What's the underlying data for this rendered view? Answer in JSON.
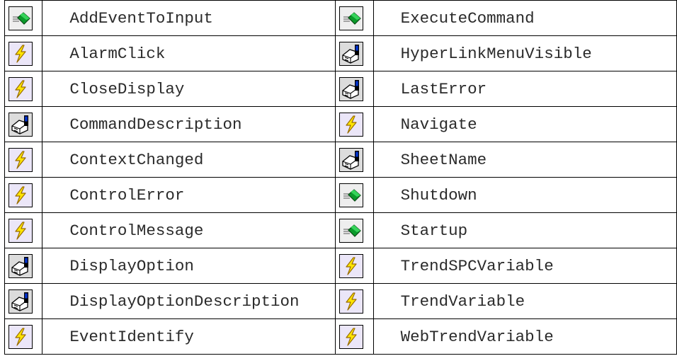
{
  "rows": [
    {
      "left": {
        "icon": "method-icon",
        "name": "AddEventToInput"
      },
      "right": {
        "icon": "method-icon",
        "name": "ExecuteCommand"
      }
    },
    {
      "left": {
        "icon": "event-icon",
        "name": "AlarmClick"
      },
      "right": {
        "icon": "property-icon",
        "name": "HyperLinkMenuVisible"
      }
    },
    {
      "left": {
        "icon": "event-icon",
        "name": "CloseDisplay"
      },
      "right": {
        "icon": "property-icon",
        "name": "LastError"
      }
    },
    {
      "left": {
        "icon": "property-icon",
        "name": "CommandDescription"
      },
      "right": {
        "icon": "event-icon",
        "name": "Navigate"
      }
    },
    {
      "left": {
        "icon": "event-icon",
        "name": "ContextChanged"
      },
      "right": {
        "icon": "property-icon",
        "name": "SheetName"
      }
    },
    {
      "left": {
        "icon": "event-icon",
        "name": "ControlError"
      },
      "right": {
        "icon": "method-icon",
        "name": "Shutdown"
      }
    },
    {
      "left": {
        "icon": "event-icon",
        "name": "ControlMessage"
      },
      "right": {
        "icon": "method-icon",
        "name": "Startup"
      }
    },
    {
      "left": {
        "icon": "property-icon",
        "name": "DisplayOption"
      },
      "right": {
        "icon": "event-icon",
        "name": "TrendSPCVariable"
      }
    },
    {
      "left": {
        "icon": "property-icon",
        "name": "DisplayOptionDescription"
      },
      "right": {
        "icon": "event-icon",
        "name": "TrendVariable"
      }
    },
    {
      "left": {
        "icon": "event-icon",
        "name": "EventIdentify"
      },
      "right": {
        "icon": "event-icon",
        "name": "WebTrendVariable"
      }
    }
  ]
}
